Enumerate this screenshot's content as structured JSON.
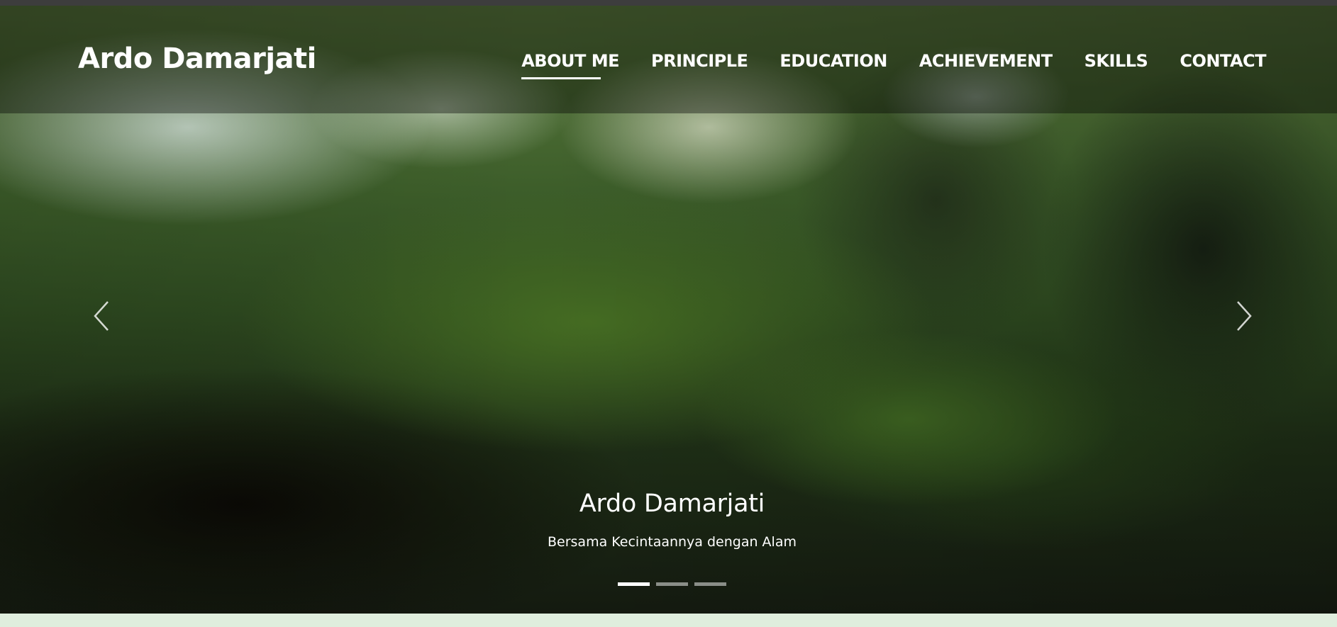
{
  "navbar": {
    "brand": "Ardo Damarjati",
    "items": [
      {
        "label": "ABOUT ME",
        "active": true
      },
      {
        "label": "PRINCIPLE",
        "active": false
      },
      {
        "label": "EDUCATION",
        "active": false
      },
      {
        "label": "ACHIEVEMENT",
        "active": false
      },
      {
        "label": "SKILLS",
        "active": false
      },
      {
        "label": "CONTACT",
        "active": false
      }
    ]
  },
  "carousel": {
    "slide": {
      "title": "Ardo Damarjati",
      "subtitle": "Bersama Kecintaannya dengan Alam"
    },
    "indicators": {
      "count": 3,
      "active_index": 0
    },
    "prev_icon": "chevron-left-icon",
    "next_icon": "chevron-right-icon"
  },
  "colors": {
    "text": "#ffffff",
    "below_section_bg": "#dfeedd"
  }
}
